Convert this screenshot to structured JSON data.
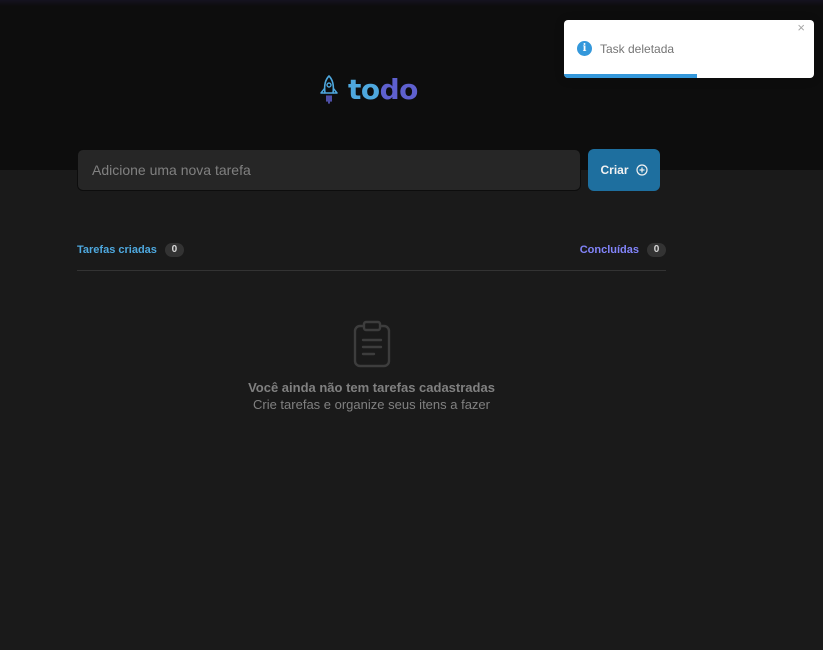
{
  "logo": {
    "text_part1": "to",
    "text_part2": "do",
    "icon": "rocket-icon",
    "color_part1": "#4ea8de",
    "color_part2": "#5e60ce"
  },
  "new_task": {
    "placeholder": "Adicione uma nova tarefa",
    "value": ""
  },
  "create_button": {
    "label": "Criar",
    "icon": "plus-circle-icon",
    "color": "#1e6f9f"
  },
  "counters": {
    "created_label": "Tarefas criadas",
    "created_count": "0",
    "done_label": "Concluídas",
    "done_count": "0"
  },
  "empty_state": {
    "icon": "clipboard-icon",
    "title": "Você ainda não tem tarefas cadastradas",
    "subtitle": "Crie tarefas e organize seus itens a fazer"
  },
  "toast": {
    "message": "Task deletada",
    "icon": "info-icon",
    "close_glyph": "×",
    "progress_fraction": 0.53,
    "color": "#3498db"
  }
}
